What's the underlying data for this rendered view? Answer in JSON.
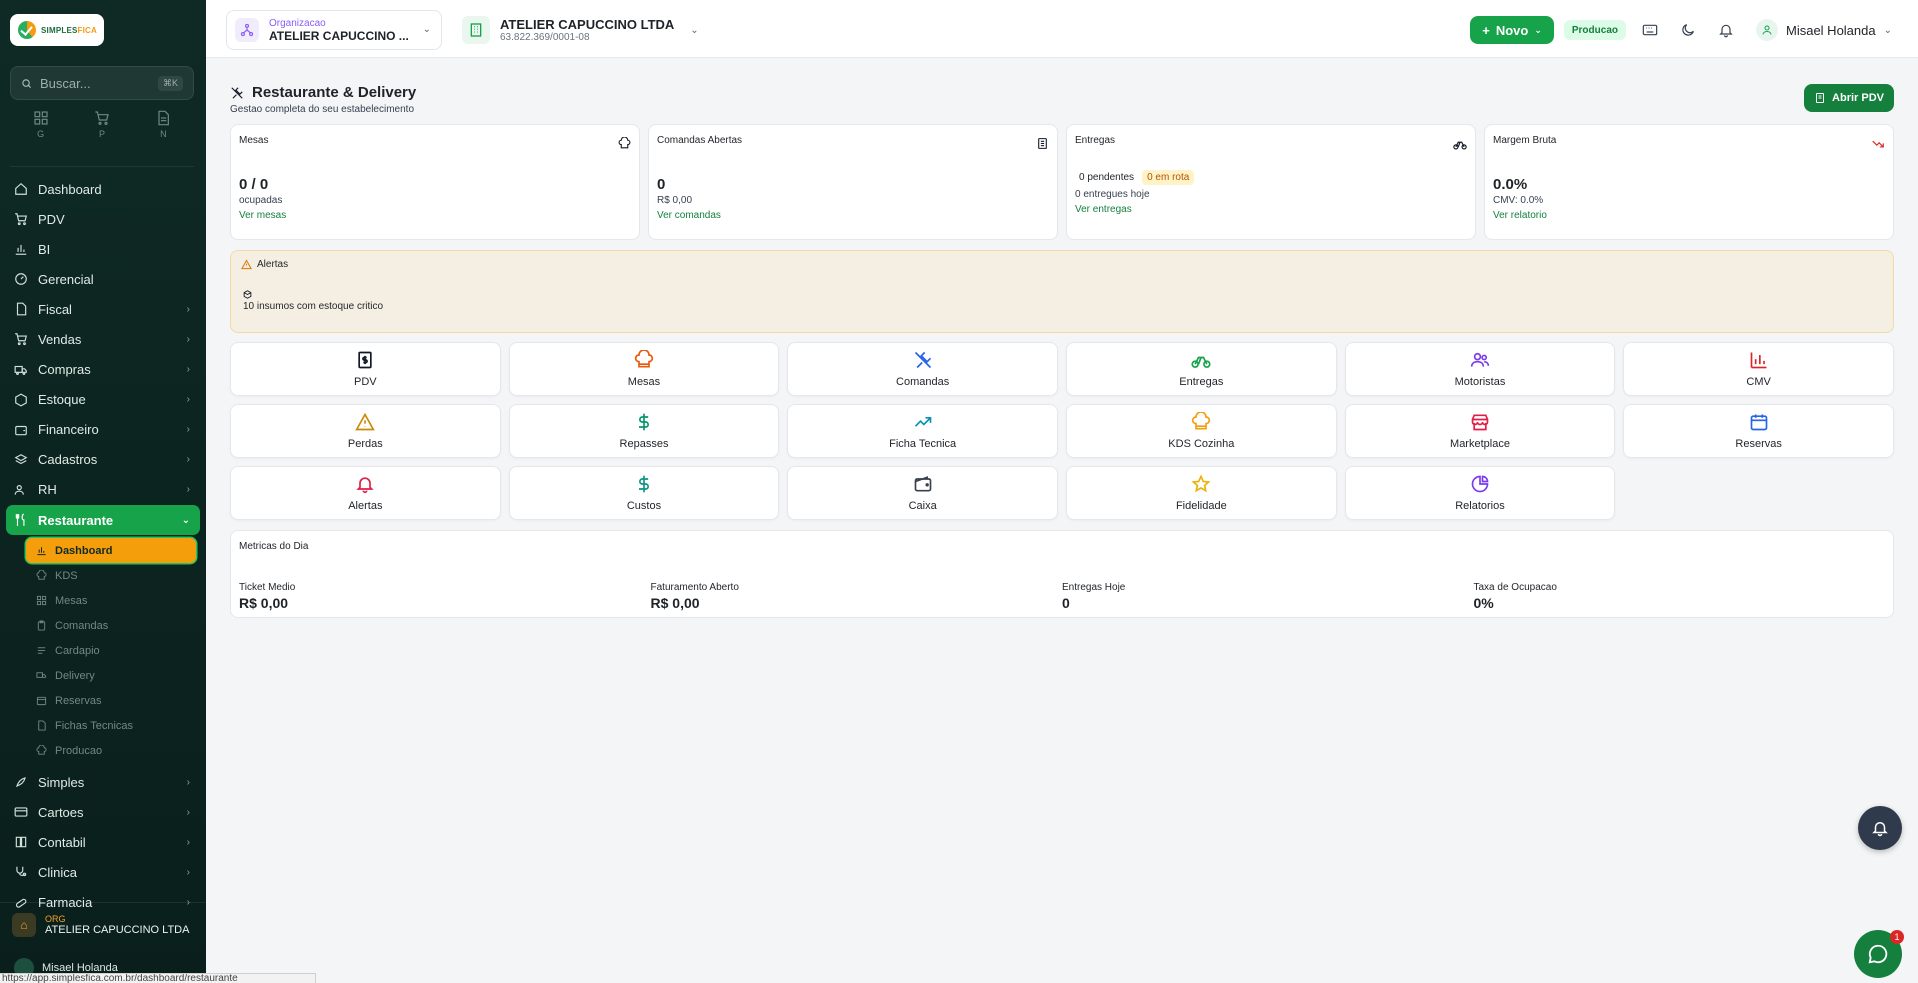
{
  "sidebar": {
    "logo": "SIMPLESFICA",
    "search_placeholder": "Buscar...",
    "search_shortcut": "⌘K",
    "quick": [
      {
        "label": "G",
        "icon": "grid-icon"
      },
      {
        "label": "P",
        "icon": "cart-icon"
      },
      {
        "label": "N",
        "icon": "document-icon"
      }
    ],
    "items": [
      {
        "label": "Dashboard",
        "icon": "home-icon"
      },
      {
        "label": "PDV",
        "icon": "cart-icon"
      },
      {
        "label": "BI",
        "icon": "bar-chart-icon"
      },
      {
        "label": "Gerencial",
        "icon": "gauge-icon"
      },
      {
        "label": "Fiscal",
        "icon": "file-icon"
      },
      {
        "label": "Vendas",
        "icon": "cart-icon"
      },
      {
        "label": "Compras",
        "icon": "truck-icon"
      },
      {
        "label": "Estoque",
        "icon": "boxes-icon"
      },
      {
        "label": "Financeiro",
        "icon": "wallet-icon"
      },
      {
        "label": "Cadastros",
        "icon": "layers-icon"
      },
      {
        "label": "RH",
        "icon": "users-icon"
      },
      {
        "label": "Restaurante",
        "icon": "utensils-icon"
      }
    ],
    "sub_items": [
      {
        "label": "Dashboard"
      },
      {
        "label": "KDS"
      },
      {
        "label": "Mesas"
      },
      {
        "label": "Comandas"
      },
      {
        "label": "Cardapio"
      },
      {
        "label": "Delivery"
      },
      {
        "label": "Reservas"
      },
      {
        "label": "Fichas Tecnicas"
      },
      {
        "label": "Producao"
      }
    ],
    "items_after": [
      {
        "label": "Simples",
        "icon": "rocket-icon"
      },
      {
        "label": "Cartoes",
        "icon": "card-icon"
      },
      {
        "label": "Contabil",
        "icon": "book-icon"
      },
      {
        "label": "Clinica",
        "icon": "stethoscope-icon"
      },
      {
        "label": "Farmacia",
        "icon": "pill-icon"
      }
    ],
    "org_label": "ORG",
    "org_name": "ATELIER CAPUCCINO LTDA",
    "user_name": "Misael Holanda",
    "status_url": "https://app.simplesfica.com.br/dashboard/restaurante"
  },
  "topbar": {
    "org_label": "Organizacao",
    "org_value": "ATELIER CAPUCCINO ...",
    "company_name": "ATELIER CAPUCCINO LTDA",
    "company_cnpj": "63.822.369/0001-08",
    "novo_label": "Novo",
    "env_badge": "Producao",
    "user_name": "Misael Holanda"
  },
  "page": {
    "title": "Restaurante & Delivery",
    "subtitle": "Gestao completa do seu estabelecimento",
    "open_pdv": "Abrir PDV"
  },
  "cards": {
    "mesas": {
      "title": "Mesas",
      "value": "0 / 0",
      "sub": "ocupadas",
      "link": "Ver mesas"
    },
    "comandas": {
      "title": "Comandas Abertas",
      "value": "0",
      "sub": "R$ 0,00",
      "link": "Ver comandas"
    },
    "entregas": {
      "title": "Entregas",
      "pendentes": "0 pendentes",
      "em_rota": "0 em rota",
      "hoje": "0 entregues hoje",
      "link": "Ver entregas"
    },
    "margem": {
      "title": "Margem Bruta",
      "value": "0.0%",
      "sub": "CMV: 0.0%",
      "link": "Ver relatorio"
    }
  },
  "alerts": {
    "title": "Alertas",
    "item": "10 insumos com estoque critico"
  },
  "tiles": [
    {
      "label": "PDV",
      "icon": "receipt-icon",
      "color": "#111827"
    },
    {
      "label": "Mesas",
      "icon": "chef-hat-icon",
      "color": "#ea580c"
    },
    {
      "label": "Comandas",
      "icon": "utensils-icon",
      "color": "#2563eb"
    },
    {
      "label": "Entregas",
      "icon": "bike-icon",
      "color": "#16a34a"
    },
    {
      "label": "Motoristas",
      "icon": "users-icon",
      "color": "#7c3aed"
    },
    {
      "label": "CMV",
      "icon": "bar-chart-icon",
      "color": "#dc2626"
    },
    {
      "label": "Perdas",
      "icon": "warning-icon",
      "color": "#ca8a04"
    },
    {
      "label": "Repasses",
      "icon": "dollar-icon",
      "color": "#059669"
    },
    {
      "label": "Ficha Tecnica",
      "icon": "trend-up-icon",
      "color": "#0891b2"
    },
    {
      "label": "KDS Cozinha",
      "icon": "chef-hat-icon",
      "color": "#f59e0b"
    },
    {
      "label": "Marketplace",
      "icon": "store-icon",
      "color": "#e11d48"
    },
    {
      "label": "Reservas",
      "icon": "calendar-icon",
      "color": "#2563eb"
    },
    {
      "label": "Alertas",
      "icon": "bell-icon",
      "color": "#e11d48"
    },
    {
      "label": "Custos",
      "icon": "dollar-icon",
      "color": "#0d9488"
    },
    {
      "label": "Caixa",
      "icon": "wallet-icon",
      "color": "#374151"
    },
    {
      "label": "Fidelidade",
      "icon": "star-icon",
      "color": "#eab308"
    },
    {
      "label": "Relatorios",
      "icon": "pie-chart-icon",
      "color": "#7c3aed"
    }
  ],
  "metrics": {
    "title": "Metricas do Dia",
    "items": [
      {
        "label": "Ticket Medio",
        "value": "R$ 0,00"
      },
      {
        "label": "Faturamento Aberto",
        "value": "R$ 0,00"
      },
      {
        "label": "Entregas Hoje",
        "value": "0"
      },
      {
        "label": "Taxa de Ocupacao",
        "value": "0%"
      }
    ]
  },
  "chat_count": "1"
}
